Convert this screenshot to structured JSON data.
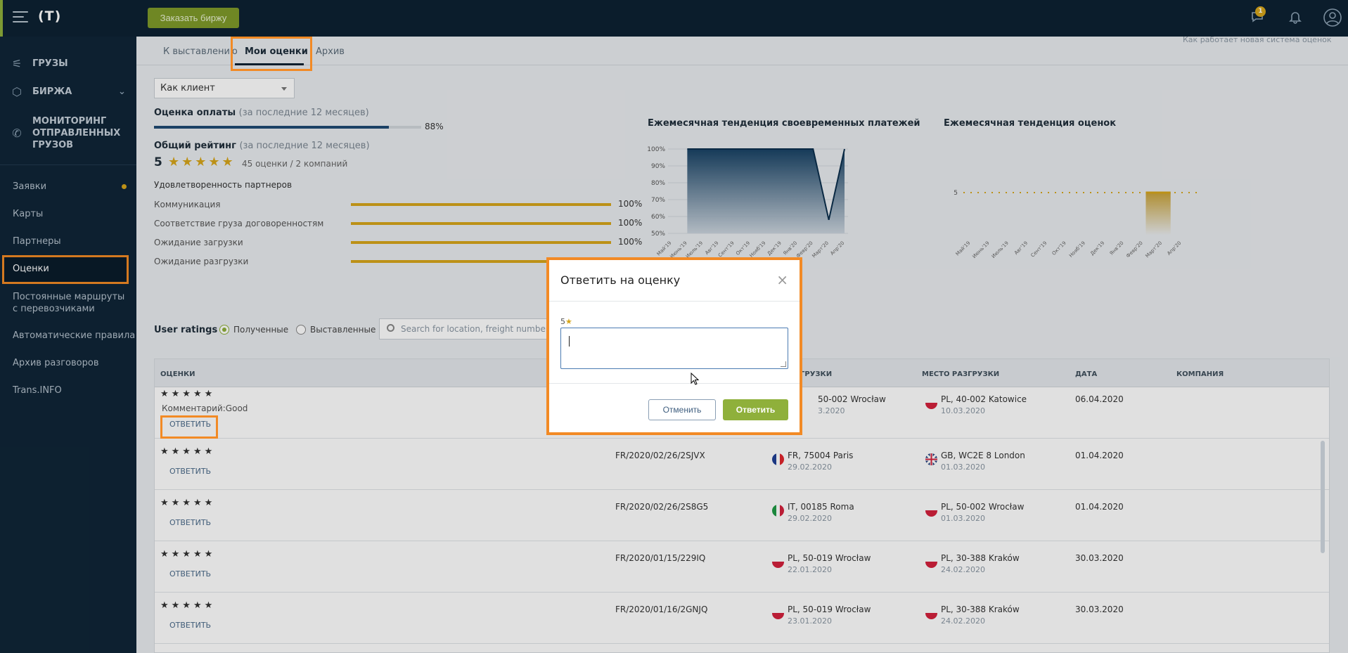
{
  "topbar": {
    "logo": "(T)",
    "order_button": "Заказать биржу",
    "messages_badge": "1"
  },
  "sidebar": {
    "main_items": [
      {
        "label": "ГРУЗЫ",
        "icon": "cargo-icon"
      },
      {
        "label": "БИРЖА",
        "icon": "exchange-icon"
      },
      {
        "label": "МОНИТОРИНГ ОТПРАВЛЕННЫХ ГРУЗОВ",
        "icon": "monitoring-icon"
      }
    ],
    "items": [
      "Заявки",
      "Карты",
      "Партнеры",
      "Оценки",
      "Постоянные маршруты с перевозчиками",
      "Автоматические правила",
      "Архив разговоров",
      "Trans.INFO"
    ],
    "active": "Оценки"
  },
  "tabs": [
    "К выставлению",
    "Мои оценки",
    "Архив"
  ],
  "active_tab": "Мои оценки",
  "hint_top": "Как работает новая система оценок",
  "role_select": "Как клиент",
  "payment": {
    "title": "Оценка оплаты",
    "period": "(за последние 12 месяцев)",
    "percent_label": "88%",
    "value": 0.88
  },
  "overall": {
    "title": "Общий рейтинг",
    "period": "(за последние 12 месяцев)",
    "score": "5",
    "stars": "★★★★★",
    "count": "45 оценки / 2 компаний"
  },
  "satisfaction": {
    "title": "Удовлетворенность партнеров",
    "rows": [
      {
        "label": "Коммуникация",
        "pct": "100%"
      },
      {
        "label": "Соответствие груза договоренностям",
        "pct": "100%"
      },
      {
        "label": "Ожидание загрузки",
        "pct": "100%"
      },
      {
        "label": "Ожидание разгрузки",
        "pct": ""
      }
    ]
  },
  "charts": {
    "payments_title": "Ежемесячная тенденция своевременных платежей",
    "ratings_title": "Ежемесячная тенденция оценок"
  },
  "chart_data": [
    {
      "type": "area",
      "title": "Ежемесячная тенденция своевременных платежей",
      "y_ticks": [
        "100%",
        "90%",
        "80%",
        "70%",
        "60%",
        "50%"
      ],
      "x": [
        "Май'19",
        "Июнь'19",
        "Июль'19",
        "Авг'19",
        "Сент'19",
        "Окт'19",
        "Нояб'19",
        "Дек'19",
        "Янв'20",
        "Февр'20",
        "Март'20",
        "Апр'20"
      ],
      "values": [
        100,
        100,
        100,
        100,
        100,
        100,
        100,
        100,
        100,
        100,
        58,
        100
      ],
      "ylim": [
        50,
        100
      ]
    },
    {
      "type": "line",
      "title": "Ежемесячная тенденция оценок",
      "y_ticks": [
        "5"
      ],
      "x": [
        "Май'19",
        "Июнь'19",
        "Июль'19",
        "Авг'19",
        "Сент'19",
        "Окт'19",
        "Нояб'19",
        "Дек'19",
        "Янв'20",
        "Февр'20",
        "Март'20",
        "Апр'20"
      ],
      "values": [
        null,
        null,
        null,
        null,
        null,
        null,
        null,
        null,
        null,
        5,
        5,
        null
      ],
      "ylim": [
        0,
        5
      ]
    }
  ],
  "user_ratings": {
    "label": "User ratings",
    "received": "Полученные",
    "given": "Выставленные",
    "search_placeholder": "Search for location, freight number and"
  },
  "table": {
    "headers": [
      "ОЦЕНКИ",
      "ГРУЗКИ",
      "МЕСТО РАЗГРУЗКИ",
      "ДАТА",
      "КОМПАНИЯ"
    ],
    "reply_label": "ОТВЕТИТЬ",
    "comment_prefix": "Комментарий:",
    "rows": [
      {
        "stars": "★★★★★",
        "comment": "Good",
        "freight": "",
        "load_place": "50-002 Wrocław",
        "load_date": "3.2020",
        "load_flag": "",
        "unload_place": "PL, 40-002 Katowice",
        "unload_date": "10.03.2020",
        "unload_flag": "pl",
        "date": "06.04.2020"
      },
      {
        "stars": "★★★★★",
        "comment": "",
        "freight": "FR/2020/02/26/2SJVX",
        "load_place": "FR, 75004 Paris",
        "load_date": "29.02.2020",
        "load_flag": "fr",
        "unload_place": "GB, WC2E 8 London",
        "unload_date": "01.03.2020",
        "unload_flag": "gb",
        "date": "01.04.2020"
      },
      {
        "stars": "★★★★★",
        "comment": "",
        "freight": "FR/2020/02/26/2S8G5",
        "load_place": "IT, 00185 Roma",
        "load_date": "29.02.2020",
        "load_flag": "it",
        "unload_place": "PL, 50-002 Wrocław",
        "unload_date": "01.03.2020",
        "unload_flag": "pl",
        "date": "01.04.2020"
      },
      {
        "stars": "★★★★★",
        "comment": "",
        "freight": "FR/2020/01/15/229IQ",
        "load_place": "PL, 50-019 Wrocław",
        "load_date": "22.01.2020",
        "load_flag": "pl",
        "unload_place": "PL, 30-388 Kraków",
        "unload_date": "24.02.2020",
        "unload_flag": "pl",
        "date": "30.03.2020"
      },
      {
        "stars": "★★★★★",
        "comment": "",
        "freight": "FR/2020/01/16/2GNJQ",
        "load_place": "PL, 50-019 Wrocław",
        "load_date": "23.01.2020",
        "load_flag": "pl",
        "unload_place": "PL, 30-388 Kraków",
        "unload_date": "24.02.2020",
        "unload_flag": "pl",
        "date": "30.03.2020"
      }
    ]
  },
  "modal": {
    "title": "Ответить на оценку",
    "rating": "5",
    "star": "★",
    "text_value": "",
    "cancel": "Отменить",
    "reply": "Ответить"
  }
}
